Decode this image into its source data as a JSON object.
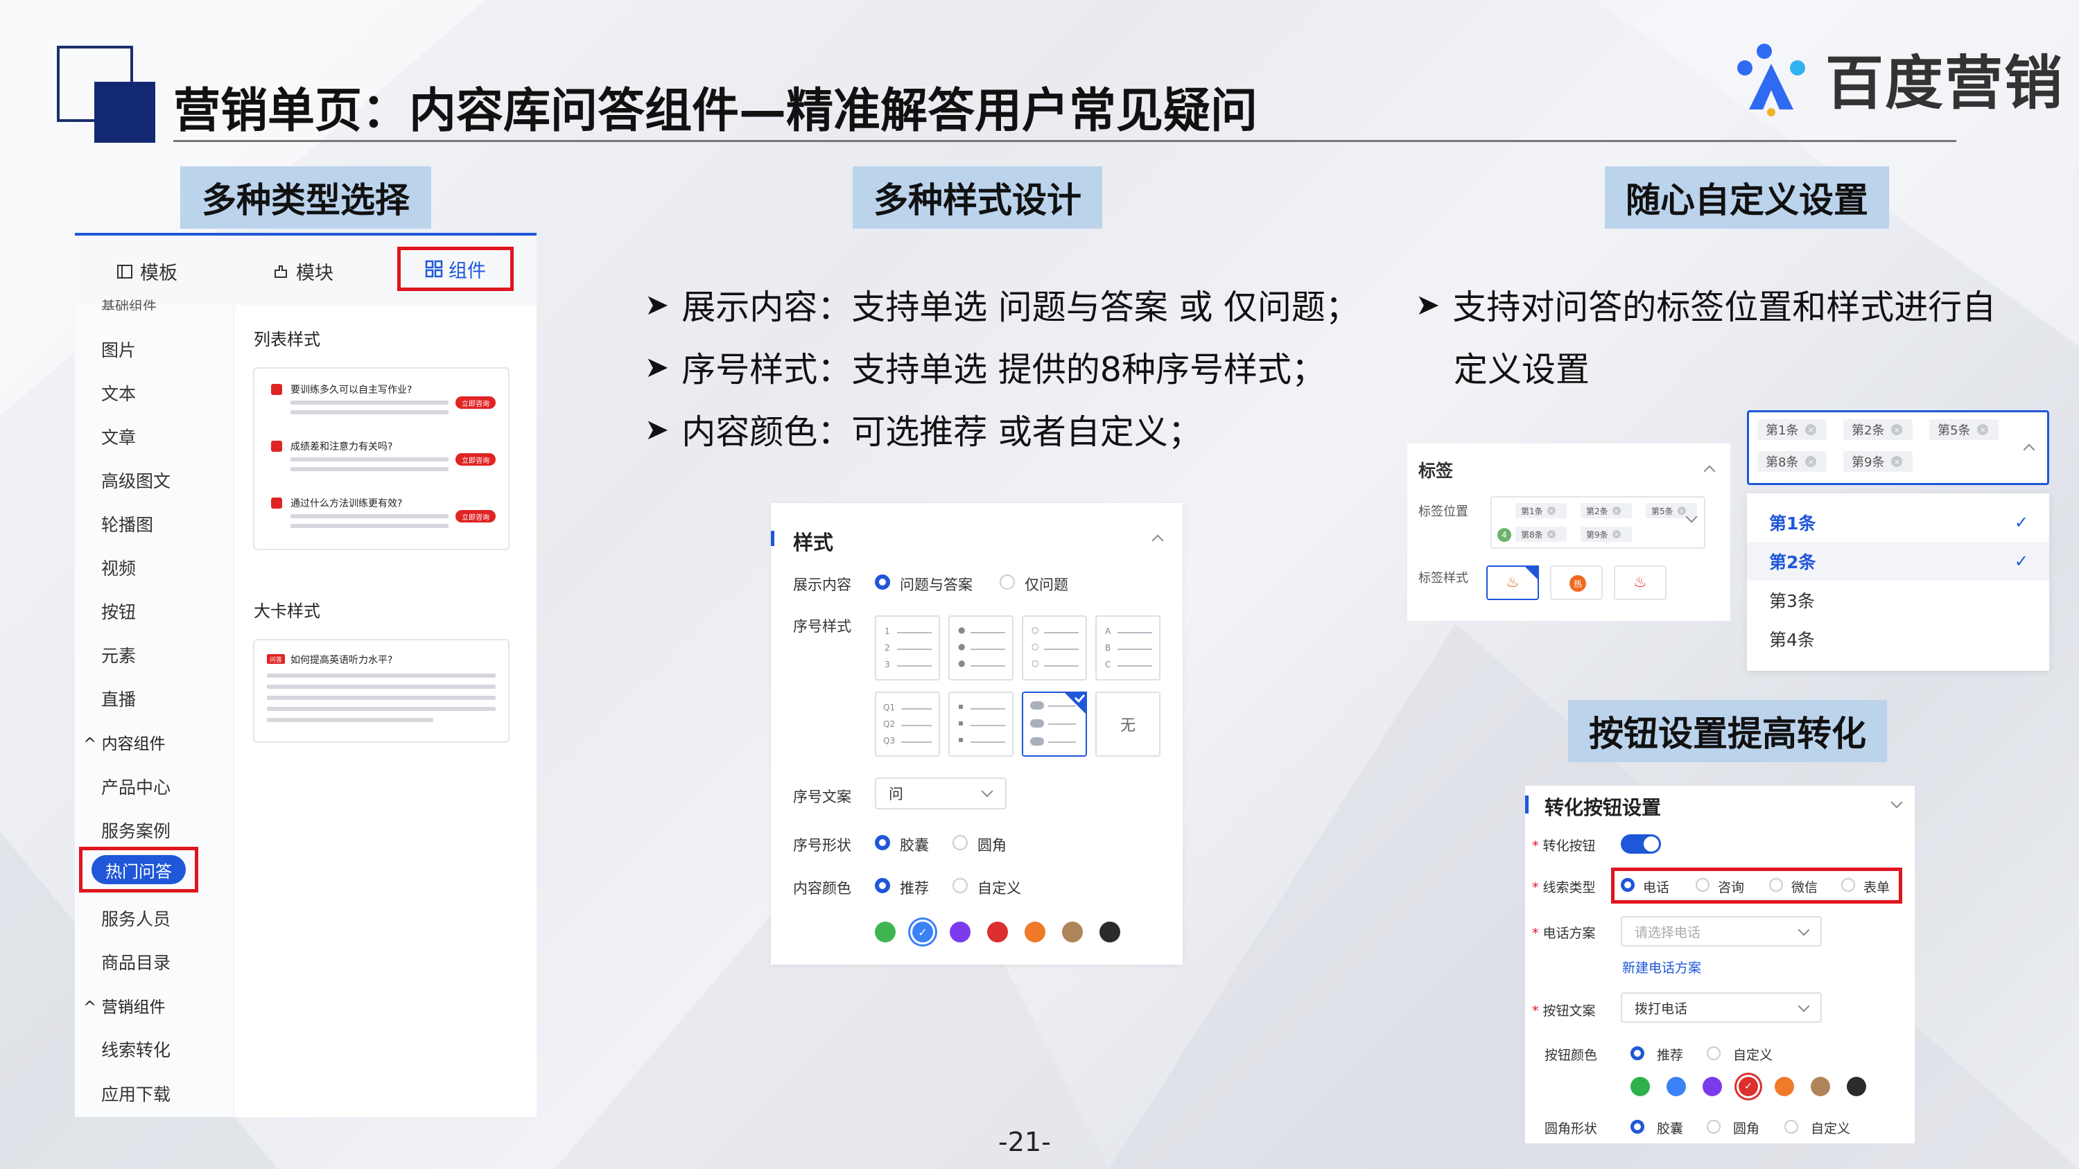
{
  "header": {
    "title": "营销单页：内容库问答组件—精准解答用户常见疑问",
    "brand": "百度营销"
  },
  "sections": {
    "types": "多种类型选择",
    "styles": "多种样式设计",
    "custom": "随心自定义设置",
    "button": "按钮设置提高转化"
  },
  "panel1": {
    "tabs": [
      "模板",
      "模块",
      "组件"
    ],
    "nav_cut": "基础组件",
    "nav": [
      "图片",
      "文本",
      "文章",
      "高级图文",
      "轮播图",
      "视频",
      "按钮",
      "元素",
      "直播"
    ],
    "group_content": "内容组件",
    "nav_content": [
      "产品中心",
      "服务案例",
      "热门问答",
      "服务人员",
      "商品目录"
    ],
    "group_marketing": "营销组件",
    "nav_marketing": [
      "线索转化",
      "应用下载"
    ],
    "list_label": "列表样式",
    "big_label": "大卡样式",
    "questions": [
      "要训练多久可以自主写作业?",
      "成绩差和注意力有关吗?",
      "通过什么方法训练更有效?"
    ],
    "consult_btn": "立即咨询",
    "big_tag": "问答",
    "big_question": "如何提高英语听力水平?"
  },
  "bullets": {
    "b1": "展示内容：支持单选 问题与答案 或 仅问题；",
    "b2": "序号样式：支持单选 提供的8种序号样式；",
    "b3": "内容颜色：可选推荐 或者自定义；",
    "b4_line1": "支持对问答的标签位置和样式进行自",
    "b4_line2": "定义设置"
  },
  "panel2": {
    "title": "样式",
    "display_label": "展示内容",
    "display_opts": [
      "问题与答案",
      "仅问题"
    ],
    "seq_style_label": "序号样式",
    "seq_none": "无",
    "seq_text_label": "序号文案",
    "seq_text_value": "问",
    "seq_shape_label": "序号形状",
    "seq_shape_opts": [
      "胶囊",
      "圆角"
    ],
    "color_label": "内容颜色",
    "color_opts": [
      "推荐",
      "自定义"
    ],
    "colors": [
      "#3fb552",
      "#3b82f6",
      "#7c3aed",
      "#dc2f2f",
      "#f07a2a",
      "#b0845a",
      "#2b2b2b"
    ]
  },
  "panel3": {
    "tag_title": "标签",
    "tag_pos_label": "标签位置",
    "tag_style_label": "标签样式",
    "chips_small": [
      "第1条",
      "第2条",
      "第5条",
      "第8条",
      "第9条"
    ],
    "badge_num": "4",
    "chips_large": [
      "第1条",
      "第2条",
      "第5条",
      "第8条",
      "第9条"
    ],
    "options": [
      "第1条",
      "第2条",
      "第3条",
      "第4条"
    ]
  },
  "panel4": {
    "title": "转化按钮设置",
    "switch_label": "转化按钮",
    "lead_label": "线索类型",
    "lead_opts": [
      "电话",
      "咨询",
      "微信",
      "表单"
    ],
    "phone_label": "电话方案",
    "phone_placeholder": "请选择电话",
    "new_phone_link": "新建电话方案",
    "btn_text_label": "按钮文案",
    "btn_text_value": "拨打电话",
    "btn_color_label": "按钮颜色",
    "btn_color_opts": [
      "推荐",
      "自定义"
    ],
    "btn_colors": [
      "#2fb14a",
      "#3b82f6",
      "#7c3aed",
      "#dc2f2f",
      "#f07a2a",
      "#b0845a",
      "#2b2b2b"
    ],
    "shape_label": "圆角形状",
    "shape_opts": [
      "胶囊",
      "圆角",
      "自定义"
    ]
  },
  "footer": {
    "page": "-21-"
  }
}
